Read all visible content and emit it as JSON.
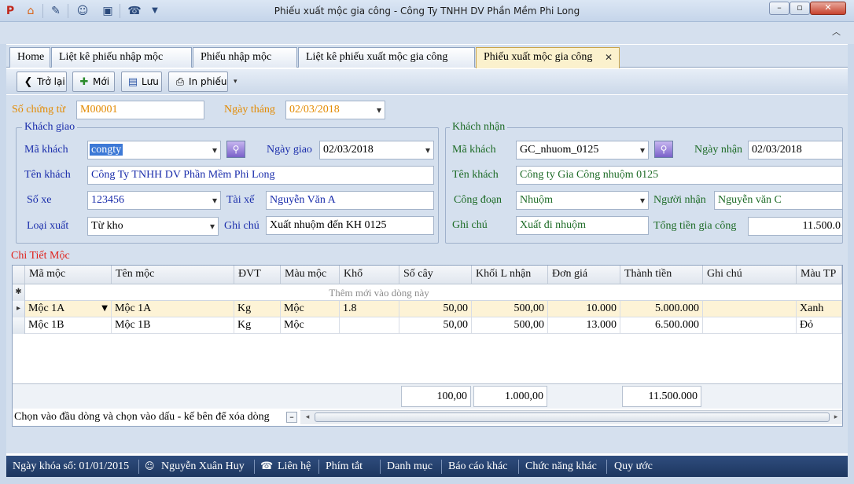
{
  "window": {
    "title": "Phiếu xuất mộc gia công - Công Ty TNHH DV Phần Mềm Phi Long"
  },
  "tabs": [
    {
      "label": "Home"
    },
    {
      "label": "Liệt kê phiếu  nhập mộc"
    },
    {
      "label": "Phiếu nhập mộc"
    },
    {
      "label": "Liệt kê phiếu xuất mộc gia công"
    },
    {
      "label": "Phiếu xuất mộc gia công"
    }
  ],
  "toolbar": {
    "back": "Trở lại",
    "new": "Mới",
    "save": "Lưu",
    "print": "In phiếu"
  },
  "voucher": {
    "number_label": "Số chứng từ",
    "number": "M00001",
    "date_label": "Ngày tháng",
    "date": "02/03/2018"
  },
  "sender": {
    "legend": "Khách giao",
    "code_label": "Mã khách",
    "code": "congty",
    "date_label": "Ngày giao",
    "date": "02/03/2018",
    "name_label": "Tên khách",
    "name": "Công Ty TNHH DV Phần Mềm Phi Long",
    "vehicle_label": "Số xe",
    "vehicle": "123456",
    "driver_label": "Tài xế",
    "driver": "Nguyễn Văn A",
    "type_label": "Loại xuất",
    "type": "Từ kho",
    "note_label": "Ghi chú",
    "note": "Xuất nhuộm đến KH 0125"
  },
  "receiver": {
    "legend": "Khách nhận",
    "code_label": "Mã khách",
    "code": "GC_nhuom_0125",
    "date_label": "Ngày nhận",
    "date": "02/03/2018",
    "name_label": "Tên khách",
    "name": "Công ty Gia Công nhuộm 0125",
    "stage_label": "Công đoạn",
    "stage": "Nhuộm",
    "person_label": "Người nhận",
    "person": "Nguyễn văn C",
    "note_label": "Ghi chú",
    "note": "Xuất đi nhuộm",
    "total_label": "Tổng tiền gia công",
    "total": "11.500.0"
  },
  "detail": {
    "title": "Chi Tiết Mộc",
    "columns": [
      "Mã mộc",
      "Tên mộc",
      "ĐVT",
      "Màu mộc",
      "Khổ",
      "Số cây",
      "Khối L nhận",
      "Đơn giá",
      "Thành tiền",
      "Ghi chú",
      "Màu TP"
    ],
    "new_row_text": "Thêm mới vào dòng này",
    "rows": [
      {
        "code": "Mộc 1A",
        "name": "Mộc 1A",
        "unit": "Kg",
        "color": "Mộc",
        "width": "1.8",
        "count": "50,00",
        "volume": "500,00",
        "price": "10.000",
        "amount": "5.000.000",
        "note": "",
        "final_color": "Xanh"
      },
      {
        "code": "Mộc 1B",
        "name": "Mộc 1B",
        "unit": "Kg",
        "color": "Mộc",
        "width": "",
        "count": "50,00",
        "volume": "500,00",
        "price": "13.000",
        "amount": "6.500.000",
        "note": "",
        "final_color": "Đỏ"
      }
    ],
    "totals": {
      "count": "100,00",
      "volume": "1.000,00",
      "amount": "11.500.000"
    },
    "hint": "Chọn vào đầu dòng và chọn vào dấu - kế bên để xóa dòng"
  },
  "status": {
    "lock_date": "Ngày khóa sổ: 01/01/2015",
    "user": "Nguyễn Xuân Huy",
    "contact": "Liên hệ",
    "shortcuts": "Phím tắt",
    "catalog": "Danh mục",
    "reports": "Báo cáo khác",
    "functions": "Chức năng khác",
    "rules": "Quy ước"
  }
}
